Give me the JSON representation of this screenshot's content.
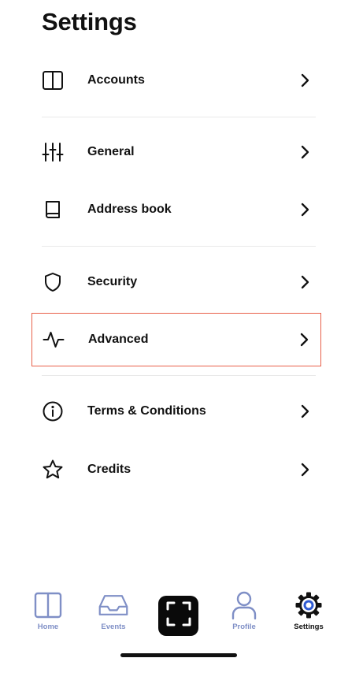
{
  "header": {
    "title": "Settings"
  },
  "settings": {
    "items": [
      {
        "label": "Accounts",
        "icon": "wallet-icon"
      },
      {
        "label": "General",
        "icon": "sliders-icon"
      },
      {
        "label": "Address book",
        "icon": "book-icon"
      },
      {
        "label": "Security",
        "icon": "shield-icon"
      },
      {
        "label": "Advanced",
        "icon": "activity-icon",
        "highlighted": true
      },
      {
        "label": "Terms & Conditions",
        "icon": "info-icon"
      },
      {
        "label": "Credits",
        "icon": "star-icon"
      }
    ]
  },
  "tabbar": {
    "tabs": [
      {
        "label": "Home",
        "icon": "wallet-icon"
      },
      {
        "label": "Events",
        "icon": "inbox-icon"
      },
      {
        "label": "",
        "icon": "scan-icon"
      },
      {
        "label": "Profile",
        "icon": "user-icon"
      },
      {
        "label": "Settings",
        "icon": "gear-icon",
        "active": true
      }
    ]
  },
  "colors": {
    "text": "#111111",
    "tab_inactive": "#7f8fc6",
    "highlight_border": "#e8604a",
    "divider": "#e9e9e9",
    "gear_accent": "#2f5bd3"
  }
}
